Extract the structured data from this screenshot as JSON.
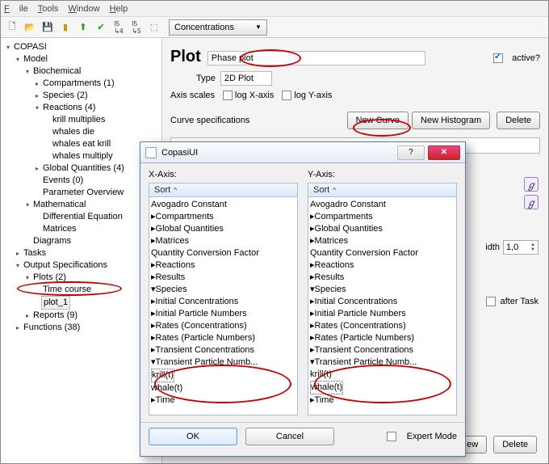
{
  "menu": {
    "file": "File",
    "tools": "Tools",
    "window": "Window",
    "help": "Help"
  },
  "toolbar": {
    "concentrations": "Concentrations"
  },
  "tree": {
    "root": "COPASI",
    "model": "Model",
    "biochemical": "Biochemical",
    "compartments": "Compartments (1)",
    "species": "Species (2)",
    "reactions": "Reactions (4)",
    "r1": "krill multiplies",
    "r2": "whales die",
    "r3": "whales eat krill",
    "r4": "whales multiply",
    "globalq": "Global Quantities (4)",
    "events": "Events (0)",
    "paramover": "Parameter Overview",
    "mathematical": "Mathematical",
    "diffeq": "Differential Equation",
    "matrices": "Matrices",
    "diagrams": "Diagrams",
    "tasks": "Tasks",
    "outputspec": "Output Specifications",
    "plots": "Plots (2)",
    "timecourse": "Time course",
    "plot1": "plot_1",
    "reports": "Reports (9)",
    "functions": "Functions (38)"
  },
  "plot": {
    "heading": "Plot",
    "name": "Phase plot",
    "active": "active?",
    "type_label": "Type",
    "type_value": "2D Plot",
    "axis_scales": "Axis scales",
    "logx": "log X-axis",
    "logy": "log Y-axis",
    "curvespec": "Curve specifications",
    "new_curve": "New Curve",
    "new_hist": "New Histogram",
    "delete": "Delete",
    "width": "idth",
    "width_val": "1,0",
    "after": "after Task",
    "new": "ew"
  },
  "dialog": {
    "title": "CopasiUI",
    "xaxis": "X-Axis:",
    "yaxis": "Y-Axis:",
    "sort": "Sort",
    "items": {
      "avogadro": "Avogadro Constant",
      "compartments": "Compartments",
      "globalq": "Global Quantities",
      "matrices": "Matrices",
      "qcf": "Quantity Conversion Factor",
      "reactions": "Reactions",
      "results": "Results",
      "species": "Species",
      "initconc": "Initial Concentrations",
      "initpart": "Initial Particle Numbers",
      "ratesc": "Rates (Concentrations)",
      "ratesp": "Rates (Particle Numbers)",
      "transc": "Transient Concentrations",
      "transp": "Transient Particle Numb...",
      "krill": "krill(t)",
      "whale": "whale(t)",
      "time": "Time"
    },
    "ok": "OK",
    "cancel": "Cancel",
    "expert": "Expert Mode"
  }
}
